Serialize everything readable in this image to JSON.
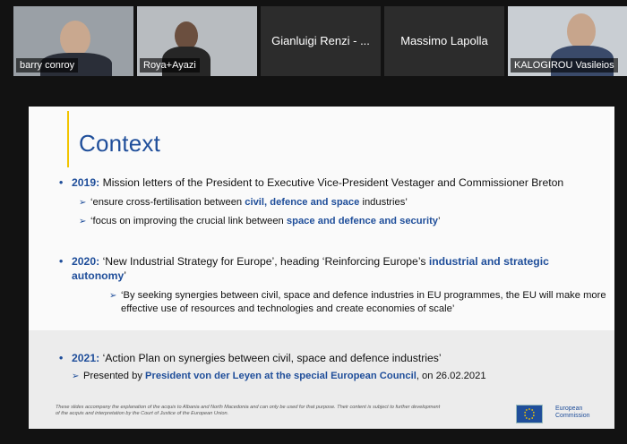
{
  "participants": [
    {
      "name": "barry conroy",
      "video": true
    },
    {
      "name": "Roya+Ayazi",
      "video": true
    },
    {
      "name": "Gianluigi Renzi - ...",
      "video": false
    },
    {
      "name": "Massimo Lapolla",
      "video": false
    },
    {
      "name": "KALOGIROU Vasileios",
      "video": true
    }
  ],
  "slide": {
    "title": "Context",
    "b2019": {
      "year": "2019:",
      "text": "Mission letters of the President to Executive Vice-President Vestager and Commissioner Breton",
      "sub1_pre": "‘ensure cross-fertilisation between ",
      "sub1_hl": "civil, defence and space",
      "sub1_post": " industries’",
      "sub2_pre": "‘focus on improving the crucial link between ",
      "sub2_hl": "space and defence and security",
      "sub2_post": "’"
    },
    "b2020": {
      "year": "2020:",
      "text_pre": "‘New Industrial Strategy for Europe’, heading ‘Reinforcing Europe’s ",
      "text_hl": "industrial and strategic autonomy",
      "text_post": "’",
      "sub1": "‘By seeking synergies between civil, space and defence industries in EU programmes, the EU will make more effective use of resources and technologies and create economies of scale’"
    },
    "b2021": {
      "year": "2021:",
      "text": "‘Action Plan on synergies between civil, space and defence industries’",
      "sub1_pre": "Presented by ",
      "sub1_hl": "President von der Leyen at the special European Council",
      "sub1_post": ", on 26.02.2021"
    },
    "footer_note": "These slides accompany the explanation of the acquis to Albania and North Macedonia and can only be used for that purpose. Their content is subject to further development of the acquis and interpretation by the Court of Justice of the European Union.",
    "logo_line1": "European",
    "logo_line2": "Commission"
  },
  "colors": {
    "accent": "#1f4e9a",
    "yellow": "#f2c400"
  }
}
